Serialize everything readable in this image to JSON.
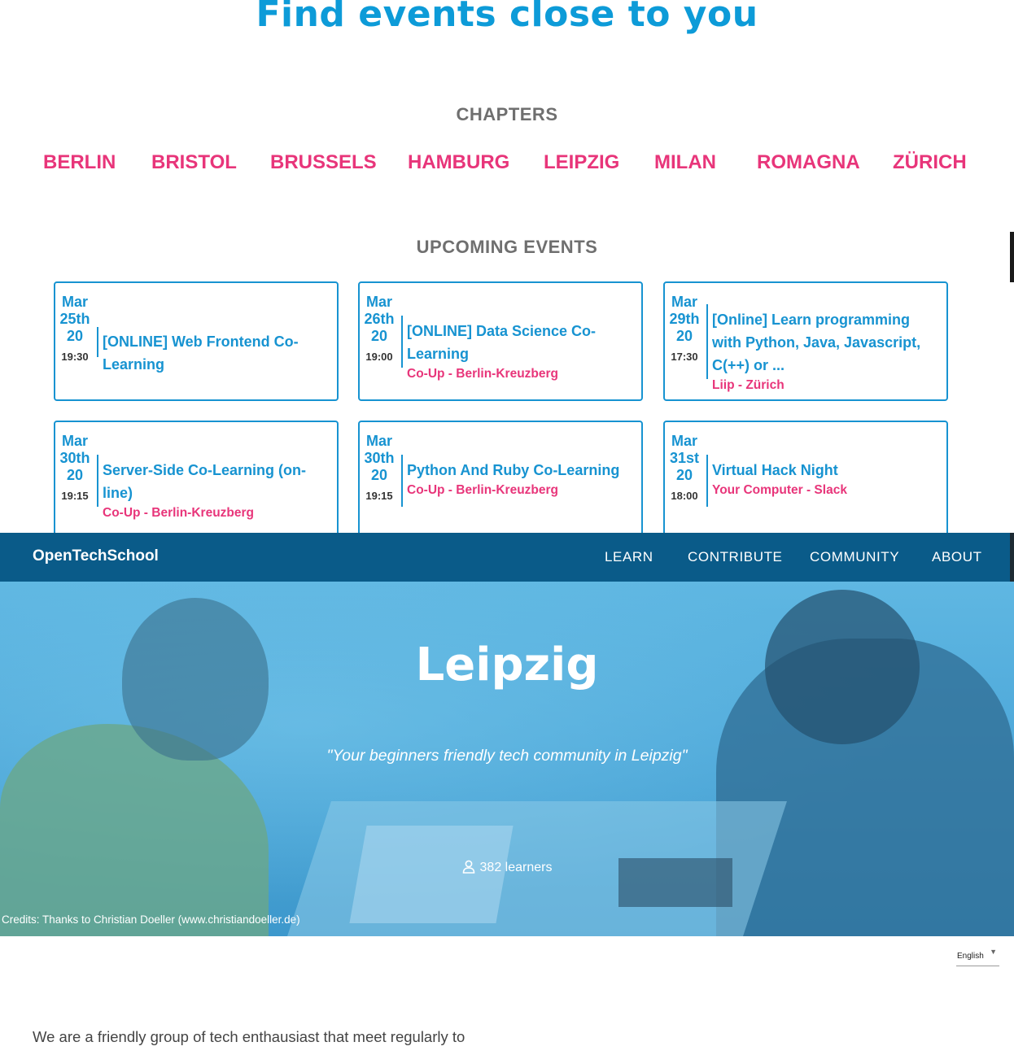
{
  "find_title": "Find events close to you",
  "chapters_title": "CHAPTERS",
  "chapters": [
    "BERLIN",
    "BRISTOL",
    "BRUSSELS",
    "HAMBURG",
    "LEIPZIG",
    "MILAN",
    "ROMAGNA",
    "ZÜRICH"
  ],
  "events_title": "UPCOMING EVENTS",
  "events": [
    {
      "month": "Mar",
      "day": "25th",
      "year": "20",
      "time": "19:30",
      "name": "[ONLINE] Web Frontend Co-Learning",
      "venue": ""
    },
    {
      "month": "Mar",
      "day": "26th",
      "year": "20",
      "time": "19:00",
      "name": "[ONLINE] Data Science Co-Learning",
      "venue": "Co-Up - Berlin-Kreuzberg"
    },
    {
      "month": "Mar",
      "day": "29th",
      "year": "20",
      "time": "17:30",
      "name": "[Online] Learn programming with Python, Java, Javascript, C(++) or ...",
      "venue": "Liip - Zürich"
    },
    {
      "month": "Mar",
      "day": "30th",
      "year": "20",
      "time": "19:15",
      "name": "Server-Side Co-Learning (on-line)",
      "venue": "Co-Up - Berlin-Kreuzberg"
    },
    {
      "month": "Mar",
      "day": "30th",
      "year": "20",
      "time": "19:15",
      "name": "Python And Ruby Co-Learning",
      "venue": "Co-Up - Berlin-Kreuzberg"
    },
    {
      "month": "Mar",
      "day": "31st",
      "year": "20",
      "time": "18:00",
      "name": "Virtual Hack Night",
      "venue": "Your Computer - Slack"
    }
  ],
  "navbar": {
    "brand": "OpenTechSchool",
    "items": [
      "LEARN",
      "CONTRIBUTE",
      "COMMUNITY",
      "ABOUT"
    ]
  },
  "hero": {
    "title": "Leipzig",
    "tagline": "\"Your beginners friendly tech community in Leipzig\"",
    "learners": "382 learners",
    "credits": "Credits: Thanks to Christian Doeller (www.christiandoeller.de)"
  },
  "language": {
    "selected": "English"
  },
  "intro_text": "We are a friendly group of tech enthausiast that meet regularly to",
  "colors": {
    "blue": "#1793d1",
    "pink": "#e8357a",
    "navbar": "#0a5b89"
  }
}
